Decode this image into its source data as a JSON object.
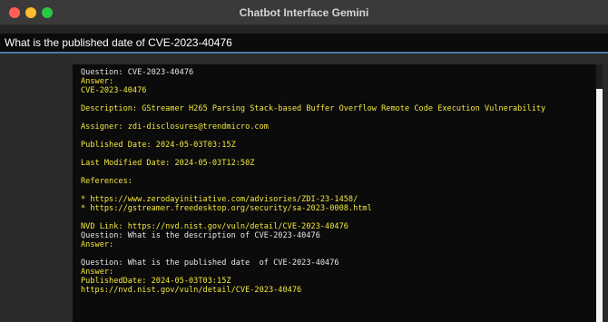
{
  "window": {
    "title": "Chatbot Interface Gemini"
  },
  "query": {
    "value": "What is the published date  of CVE-2023-40476"
  },
  "output": {
    "q1": "Question: CVE-2023-40476",
    "a1_label": "Answer:",
    "cve_id": "CVE-2023-40476",
    "description": "Description: GStreamer H265 Parsing Stack-based Buffer Overflow Remote Code Execution Vulnerability",
    "assigner": "Assigner: zdi-disclosures@trendmicro.com",
    "published": "Published Date: 2024-05-03T03:15Z",
    "last_modified": "Last Modified Date: 2024-05-03T12:50Z",
    "references_label": "References:",
    "ref1": "* https://www.zerodayinitiative.com/advisories/ZDI-23-1458/",
    "ref2": "* https://gstreamer.freedesktop.org/security/sa-2023-0008.html",
    "nvd_link": "NVD Link: https://nvd.nist.gov/vuln/detail/CVE-2023-40476",
    "q2": "Question: What is the description of CVE-2023-40476",
    "a2_label": "Answer:",
    "q3": "Question: What is the published date  of CVE-2023-40476",
    "a3_label": "Answer:",
    "a3_value": "PublishedDate: 2024-05-03T03:15Z",
    "a3_link": "https://nvd.nist.gov/vuln/detail/CVE-2023-40476"
  },
  "colors": {
    "answer_text": "#f2e73e",
    "question_text": "#e6e6e6",
    "input_border": "#4a78a8"
  }
}
